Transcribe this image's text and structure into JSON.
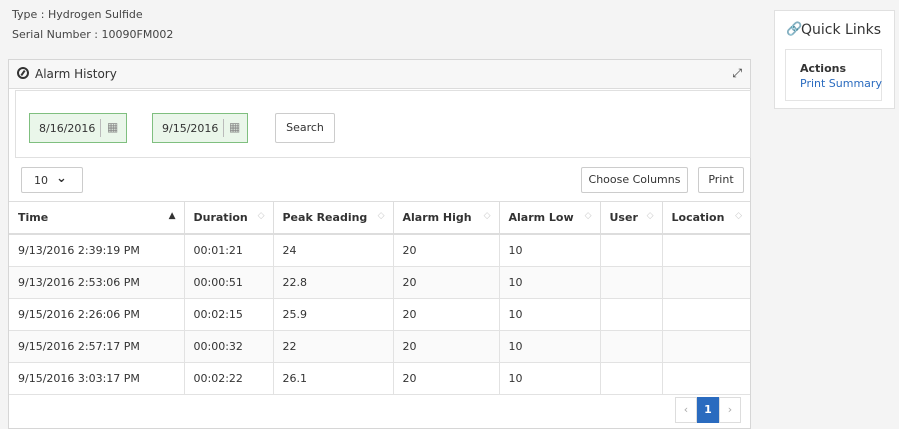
{
  "device": {
    "type_line": "Type : Hydrogen Sulfide",
    "serial_line": "Serial Number : 10090FM002"
  },
  "panel": {
    "title": "Alarm History",
    "icons": {
      "title": "compass-icon",
      "expand": "expand-icon"
    }
  },
  "filters": {
    "from_date": "8/16/2016",
    "to_date": "9/15/2016",
    "search_label": "Search",
    "calendar_icon": "calendar-icon"
  },
  "toolbar": {
    "page_size": "10",
    "choose_columns_label": "Choose Columns",
    "print_label": "Print"
  },
  "table": {
    "columns": [
      "Time",
      "Duration",
      "Peak Reading",
      "Alarm High",
      "Alarm Low",
      "User",
      "Location"
    ],
    "sorted_column": "Time",
    "rows": [
      [
        "9/13/2016 2:39:19 PM",
        "00:01:21",
        "24",
        "20",
        "10",
        "",
        ""
      ],
      [
        "9/13/2016 2:53:06 PM",
        "00:00:51",
        "22.8",
        "20",
        "10",
        "",
        ""
      ],
      [
        "9/15/2016 2:26:06 PM",
        "00:02:15",
        "25.9",
        "20",
        "10",
        "",
        ""
      ],
      [
        "9/15/2016 2:57:17 PM",
        "00:00:32",
        "22",
        "20",
        "10",
        "",
        ""
      ],
      [
        "9/15/2016 3:03:17 PM",
        "00:02:22",
        "26.1",
        "20",
        "10",
        "",
        ""
      ]
    ]
  },
  "pagination": {
    "prev": "‹",
    "current": "1",
    "next": "›"
  },
  "quick_links": {
    "title": "Quick Links",
    "actions_label": "Actions",
    "print_summary_label": "Print Summary"
  },
  "colors": {
    "accent": "#2a6bbf",
    "date_field_bg": "#eaf6ea",
    "date_field_border": "#7fbf7f"
  }
}
